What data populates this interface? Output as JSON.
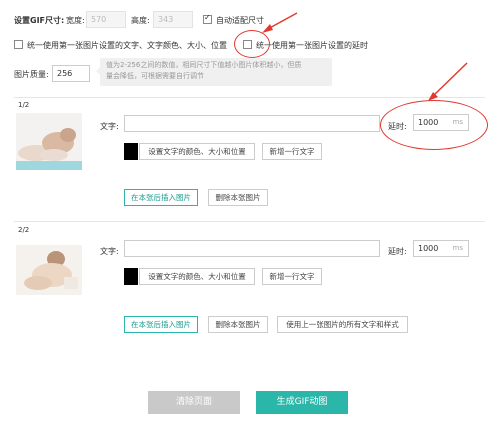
{
  "settings": {
    "gif_size_label": "设置GIF尺寸:",
    "width_label": "宽度:",
    "width_value": "570",
    "height_label": "高度:",
    "height_value": "343",
    "auto_size_label": "自动适配尺寸",
    "auto_size_checked": true,
    "unify_style_label": "统一使用第一张图片设置的文字、文字颜色、大小、位置",
    "unify_delay_label": "统一使用第一张图片设置的延时",
    "quality_label": "图片质量:",
    "quality_value": "256",
    "quality_tip_line1": "值为2-256之间的数值，相同尺寸下值越小图片体积越小，但质",
    "quality_tip_line2": "量会降低，可根据需要自行调节"
  },
  "frames": [
    {
      "index": "1/2",
      "text_label": "文字:",
      "text_value": "",
      "delay_label": "延时:",
      "delay_value": "1000",
      "delay_unit": "ms",
      "style_button": "设置文字的颜色、大小和位置",
      "add_line_button": "新增一行文字",
      "insert_button": "在本张后插入图片",
      "delete_button": "删除本张图片"
    },
    {
      "index": "2/2",
      "text_label": "文字:",
      "text_value": "",
      "delay_label": "延时:",
      "delay_value": "1000",
      "delay_unit": "ms",
      "style_button": "设置文字的颜色、大小和位置",
      "add_line_button": "新增一行文字",
      "insert_button": "在本张后插入图片",
      "delete_button": "删除本张图片",
      "copy_prev_button": "使用上一张图片的所有文字和样式"
    }
  ],
  "footer": {
    "clear_button": "清除页面",
    "generate_button": "生成GIF动图"
  },
  "colors": {
    "accent": "#2ab7a9",
    "annotation": "#e03a2f",
    "clear_button_bg": "#c9c9c9",
    "generate_button_bg": "#2ab7a9"
  }
}
